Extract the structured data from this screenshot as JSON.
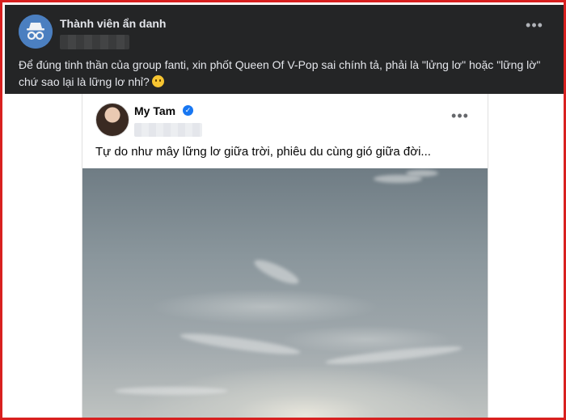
{
  "outer_post": {
    "author": "Thành viên ẩn danh",
    "text": "Để đúng tinh thần của group fanti, xin phốt Queen Of V-Pop sai chính tả, phải là \"lửng lơ\" hoặc \"lững lờ\" chứ sao lại là lững lơ nhỉ?",
    "more_label": "•••",
    "avatar_icon": "incognito-icon",
    "emoji_icon": "grimace-emoji-icon"
  },
  "shared_post": {
    "author": "My Tam",
    "verified": true,
    "verified_icon": "verified-badge-icon",
    "text": "Tự do như mây lững lơ giữa trời, phiêu du cùng gió giữa đời...",
    "more_label": "•••"
  },
  "colors": {
    "frame": "#d8201f",
    "dark_bg": "#242526",
    "verified_blue": "#1877f2"
  }
}
